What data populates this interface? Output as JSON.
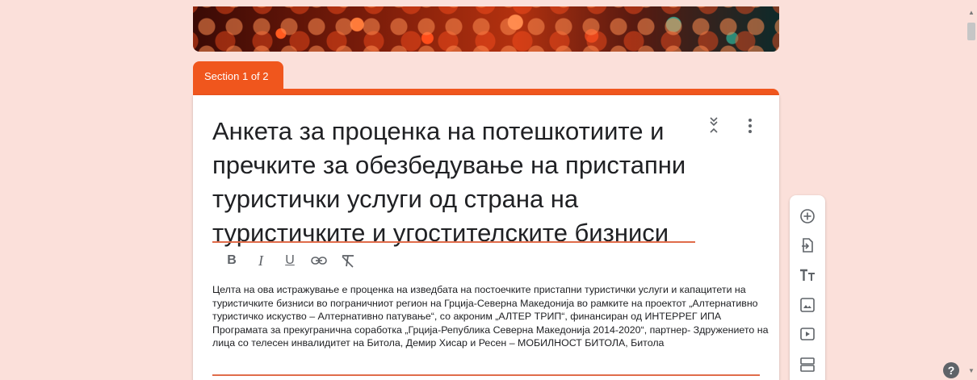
{
  "section": {
    "label": "Section 1 of 2"
  },
  "form": {
    "title": "Анкета за проценка на потешкотиите и пречките за обезбедување на пристапни туристички услуги од страна на туристичките и угостителските бизниси",
    "description": "Целта на ова истражување е проценка на изведбата на постоечките пристапни туристички услуги и капацитети на туристичките бизниси во пограничниот регион на Грција-Северна Македонија во рамките на проектот „Алтернативно туристичко искуство – Алтернативно патување“, со акроним „АЛТЕР ТРИП“, финансиран од ИНТЕРРЕГ ИПА Програмата за прекугранична соработка „Грција-Република Северна Македонија 2014-2020“,    партнер- Здружението на лица со телесен инвалидитет на Битола, Демир Хисар и Ресен – МОБИЛНОСТ БИТОЛА, Битола"
  },
  "format_toolbar": {
    "bold": "B",
    "italic": "I",
    "underline": "U"
  },
  "sidebar_tools": [
    "add-question-icon",
    "import-questions-icon",
    "add-title-icon",
    "add-image-icon",
    "add-video-icon",
    "add-section-icon"
  ],
  "help": {
    "label": "?"
  },
  "colors": {
    "accent": "#f0561d",
    "background": "#fbe0da",
    "underline": "#e06c4a"
  }
}
